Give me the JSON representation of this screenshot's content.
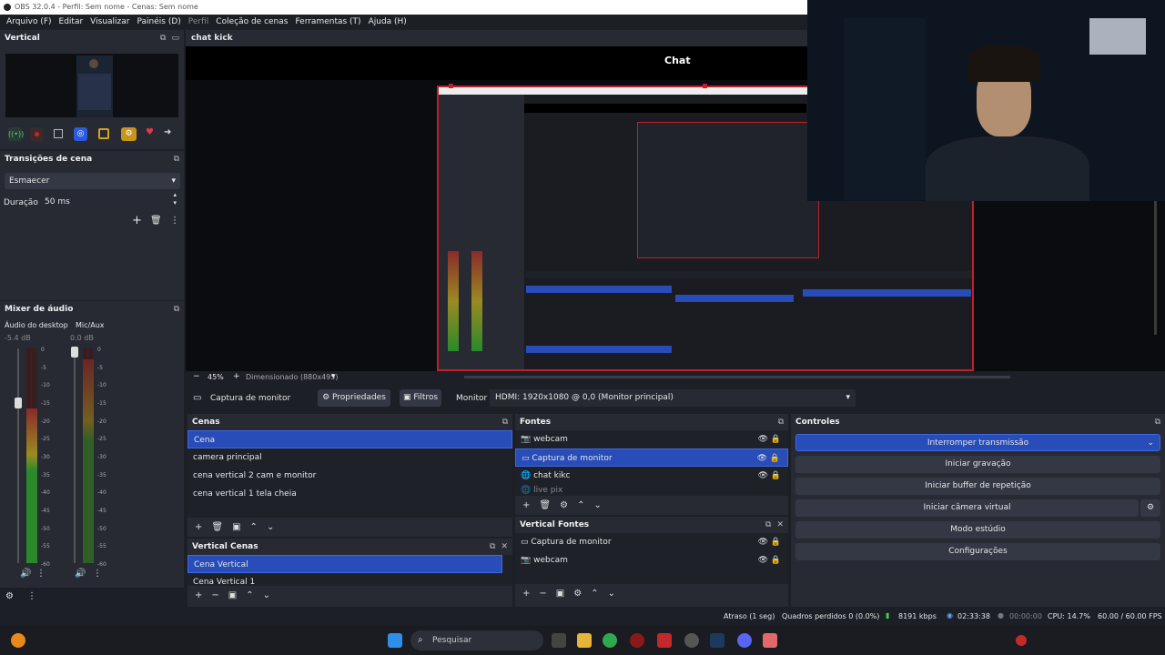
{
  "window": {
    "title": "OBS 32.0.4 - Perfil: Sem nome - Cenas: Sem nome"
  },
  "menu": {
    "items": [
      {
        "label": "Arquivo (F)",
        "dim": false
      },
      {
        "label": "Editar",
        "dim": false
      },
      {
        "label": "Visualizar",
        "dim": false
      },
      {
        "label": "Painéis (D)",
        "dim": false
      },
      {
        "label": "Perfil",
        "dim": true
      },
      {
        "label": "Coleção de cenas",
        "dim": false
      },
      {
        "label": "Ferramentas (T)",
        "dim": false
      },
      {
        "label": "Ajuda (H)",
        "dim": false
      }
    ]
  },
  "vertical_panel": {
    "title": "Vertical"
  },
  "preview_panel": {
    "title": "chat kick",
    "overlay_label": "Chat"
  },
  "transitions": {
    "title": "Transições de cena",
    "selected": "Esmaecer",
    "duration_label": "Duração",
    "duration_value": "50 ms"
  },
  "audio_mixer": {
    "title": "Mixer de áudio",
    "channels": [
      {
        "name": "Áudio do desktop",
        "db": "-5.4 dB",
        "level": 0.72
      },
      {
        "name": "Mic/Aux",
        "db": "0.0 dB",
        "level": 0.95
      }
    ],
    "ticks": [
      "0",
      "-5",
      "-10",
      "-15",
      "-20",
      "-25",
      "-30",
      "-35",
      "-40",
      "-45",
      "-50",
      "-55",
      "-60"
    ]
  },
  "preview_toolbar": {
    "zoom": "45%",
    "dimension": "Dimensionado (880x495)"
  },
  "source_bar": {
    "source": "Captura de monitor",
    "properties": "Propriedades",
    "filters": "Filtros",
    "monitor_label": "Monitor",
    "monitor_value": "HDMI: 1920x1080 @ 0,0 (Monitor principal)"
  },
  "scenes": {
    "title": "Cenas",
    "items": [
      "Cena",
      "camera principal",
      "cena vertical 2 cam e monitor",
      "cena vertical 1 tela cheia"
    ],
    "selected_index": 0
  },
  "vertical_scenes": {
    "title": "Vertical Cenas",
    "items": [
      "Cena Vertical",
      "Cena Vertical 1"
    ]
  },
  "sources": {
    "title": "Fontes",
    "items": [
      {
        "name": "webcam",
        "icon": "camera-icon"
      },
      {
        "name": "Captura de monitor",
        "icon": "monitor-icon"
      },
      {
        "name": "chat kikc",
        "icon": "globe-icon"
      },
      {
        "name": "live pix",
        "icon": "globe-icon"
      }
    ],
    "selected_index": 1
  },
  "vertical_sources": {
    "title": "Vertical Fontes",
    "items": [
      {
        "name": "Captura de monitor",
        "icon": "monitor-icon"
      },
      {
        "name": "webcam",
        "icon": "camera-icon"
      }
    ]
  },
  "controls": {
    "title": "Controles",
    "stop_stream": "Interromper transmissão",
    "start_recording": "Iniciar gravação",
    "start_replay": "Iniciar buffer de repetição",
    "start_virtualcam": "Iniciar câmera virtual",
    "studio_mode": "Modo estúdio",
    "settings": "Configurações"
  },
  "statusbar": {
    "delay": "Atraso (1 seg)",
    "dropped": "Quadros perdidos 0 (0.0%)",
    "bitrate": "8191 kbps",
    "stream_time": "02:33:38",
    "rec_time": "00:00:00",
    "cpu": "CPU: 14.7%",
    "fps": "60.00 / 60.00 FPS"
  },
  "taskbar": {
    "search_placeholder": "Pesquisar"
  },
  "colors": {
    "accent": "#284cb8",
    "panel": "#272a33",
    "bg": "#1d1f26"
  }
}
